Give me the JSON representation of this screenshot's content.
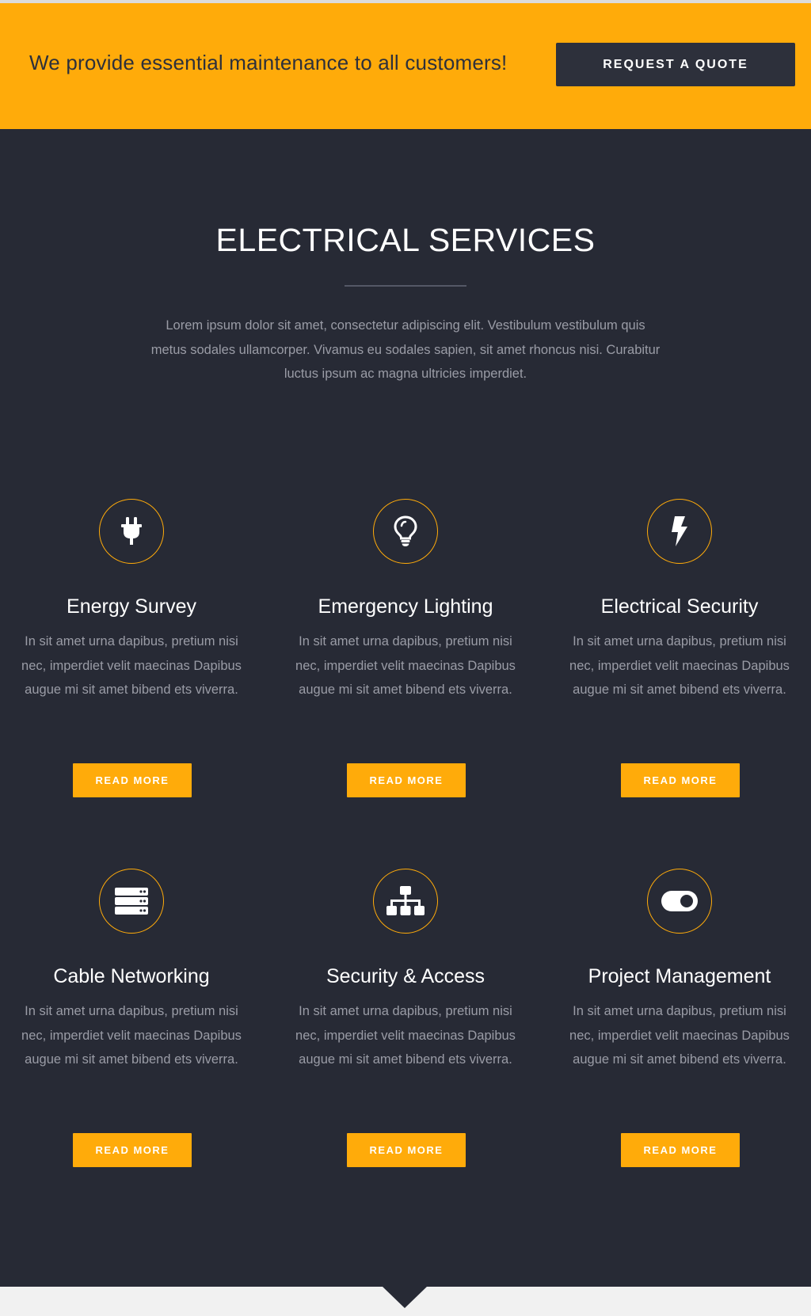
{
  "banner": {
    "text": "We provide essential maintenance to all customers!",
    "button_label": "REQUEST A QUOTE"
  },
  "services": {
    "title": "ELECTRICAL SERVICES",
    "intro": "Lorem ipsum dolor sit amet, consectetur adipiscing elit. Vestibulum vestibulum quis metus sodales ullamcorper. Vivamus eu sodales sapien, sit amet rhoncus nisi. Curabitur luctus ipsum ac magna ultricies imperdiet.",
    "items": [
      {
        "icon": "plug-icon",
        "title": "Energy Survey",
        "text": "In sit amet urna dapibus, pretium nisi nec, imperdiet velit maecinas Dapibus augue mi sit amet bibend ets viverra.",
        "button": "READ MORE"
      },
      {
        "icon": "lightbulb-icon",
        "title": "Emergency Lighting",
        "text": "In sit amet urna dapibus, pretium nisi nec, imperdiet velit maecinas Dapibus augue mi sit amet bibend ets viverra.",
        "button": "READ MORE"
      },
      {
        "icon": "bolt-icon",
        "title": "Electrical Security",
        "text": "In sit amet urna dapibus, pretium nisi nec, imperdiet velit maecinas Dapibus augue mi sit amet bibend ets viverra.",
        "button": "READ MORE"
      },
      {
        "icon": "server-icon",
        "title": "Cable Networking",
        "text": "In sit amet urna dapibus, pretium nisi nec, imperdiet velit maecinas Dapibus augue mi sit amet bibend ets viverra.",
        "button": "READ MORE"
      },
      {
        "icon": "sitemap-icon",
        "title": "Security & Access",
        "text": "In sit amet urna dapibus, pretium nisi nec, imperdiet velit maecinas Dapibus augue mi sit amet bibend ets viverra.",
        "button": "READ MORE"
      },
      {
        "icon": "toggle-icon",
        "title": "Project Management",
        "text": "In sit amet urna dapibus, pretium nisi nec, imperdiet velit maecinas Dapibus augue mi sit amet bibend ets viverra.",
        "button": "READ MORE"
      }
    ]
  },
  "colors": {
    "accent": "#ffab0a",
    "dark": "#272a35",
    "button_dark": "#2d303b",
    "muted_text": "#9a9ca6"
  }
}
